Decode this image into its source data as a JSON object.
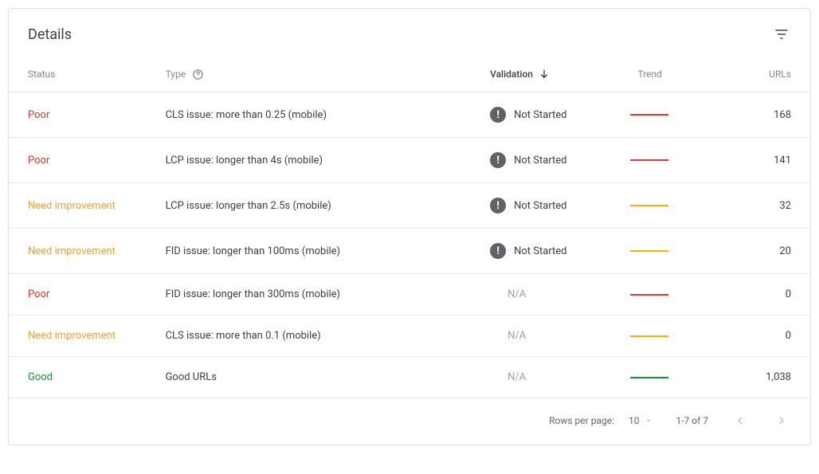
{
  "title": "Details",
  "columns": {
    "status": "Status",
    "type": "Type",
    "validation": "Validation",
    "trend": "Trend",
    "urls": "URLs"
  },
  "status_labels": {
    "poor": "Poor",
    "need": "Need improvement",
    "good": "Good"
  },
  "validation_labels": {
    "not_started": "Not Started",
    "na": "N/A"
  },
  "rows": [
    {
      "status": "poor",
      "type": "CLS issue: more than 0.25 (mobile)",
      "validation": "not_started",
      "trend": "red",
      "urls": "168"
    },
    {
      "status": "poor",
      "type": "LCP issue: longer than 4s (mobile)",
      "validation": "not_started",
      "trend": "red",
      "urls": "141"
    },
    {
      "status": "need",
      "type": "LCP issue: longer than 2.5s (mobile)",
      "validation": "not_started",
      "trend": "amber",
      "urls": "32"
    },
    {
      "status": "need",
      "type": "FID issue: longer than 100ms (mobile)",
      "validation": "not_started",
      "trend": "amber",
      "urls": "20"
    },
    {
      "status": "poor",
      "type": "FID issue: longer than 300ms (mobile)",
      "validation": "na",
      "trend": "red",
      "urls": "0"
    },
    {
      "status": "need",
      "type": "CLS issue: more than 0.1 (mobile)",
      "validation": "na",
      "trend": "amber",
      "urls": "0"
    },
    {
      "status": "good",
      "type": "Good URLs",
      "validation": "na",
      "trend": "green",
      "urls": "1,038"
    }
  ],
  "footer": {
    "rows_per_page_label": "Rows per page:",
    "rows_per_page_value": "10",
    "range": "1-7 of 7"
  }
}
